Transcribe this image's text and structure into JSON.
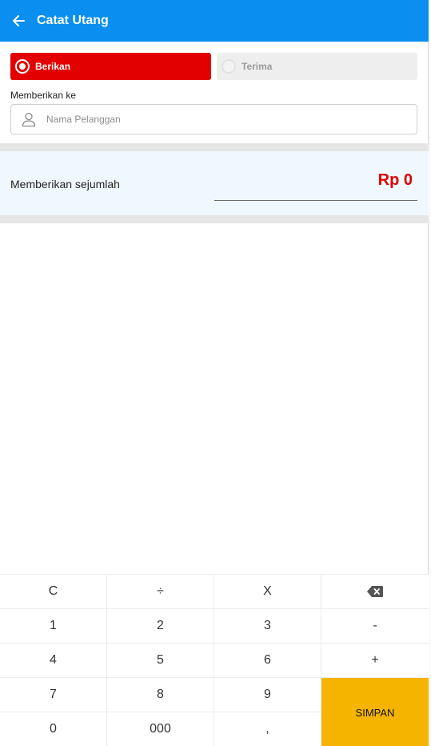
{
  "appbar": {
    "title": "Catat Utang",
    "back_icon": "arrow-left-icon",
    "color": "#0a8ff0"
  },
  "mode": {
    "berikan_label": "Berikan",
    "terima_label": "Terima",
    "selected": "Berikan",
    "active_color": "#e30000"
  },
  "customer": {
    "label": "Memberikan ke",
    "placeholder": "Nama Pelanggan",
    "value": "",
    "icon": "person-icon"
  },
  "amount": {
    "label": "Memberikan sejumlah",
    "value": "Rp 0",
    "color": "#e00000"
  },
  "keypad": {
    "clear": "C",
    "divide": "÷",
    "multiply": "X",
    "backspace_icon": "backspace-icon",
    "one": "1",
    "two": "2",
    "three": "3",
    "minus": "-",
    "four": "4",
    "five": "5",
    "six": "6",
    "plus": "+",
    "seven": "7",
    "eight": "8",
    "nine": "9",
    "save": "SIMPAN",
    "zero": "0",
    "triple_zero": "000",
    "comma": ",",
    "save_color": "#f5b400"
  }
}
